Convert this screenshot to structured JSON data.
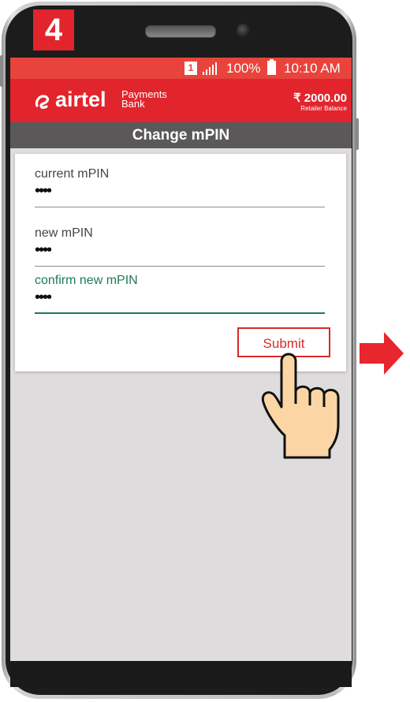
{
  "step": {
    "number": "4"
  },
  "statusbar": {
    "sim_slot": "1",
    "battery": "100%",
    "time": "10:10 AM"
  },
  "header": {
    "brand": "airtel",
    "brand_sub_line1": "Payments",
    "brand_sub_line2": "Bank",
    "balance_amount": "₹ 2000.00",
    "balance_label": "Retailer Balance"
  },
  "page": {
    "title": "Change mPIN"
  },
  "form": {
    "fields": [
      {
        "label": "current mPIN",
        "value": "••••"
      },
      {
        "label": "new mPIN",
        "value": "••••"
      },
      {
        "label": "confirm new mPIN",
        "value": "••••"
      }
    ],
    "submit_label": "Submit"
  },
  "colors": {
    "brand_red": "#e2242c",
    "statusbar": "#e8433c",
    "titlebar": "#5a5858",
    "focus_green": "#1e7a52",
    "screen_bg": "#dedcdc"
  },
  "icons": [
    "sim-icon",
    "signal-icon",
    "battery-icon",
    "airtel-logo-icon",
    "next-arrow-icon",
    "pointing-hand-icon"
  ]
}
